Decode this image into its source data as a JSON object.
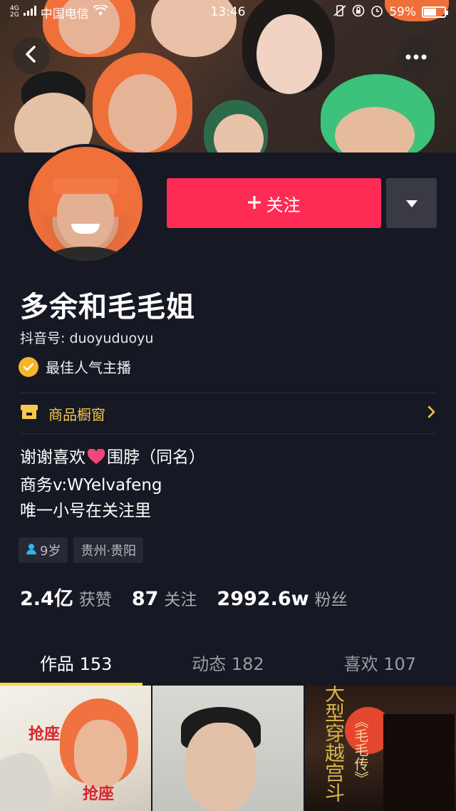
{
  "status_bar": {
    "network_top": "4G",
    "network_bottom": "2G",
    "carrier": "中国电信",
    "time": "13:46",
    "battery": "59%",
    "battery_level": 0.59
  },
  "profile": {
    "name": "多余和毛毛姐",
    "douyin_id": "抖音号: duoyuduoyu",
    "verification": "最佳人气主播",
    "follow_label": "关注",
    "shop_label": "商品橱窗",
    "bio_lines": [
      "谢谢喜欢",
      "围脖（同名）",
      "商务v:WYelvafeng",
      "唯一小号在关注里"
    ],
    "tags": {
      "age": "9岁",
      "location": "贵州·贵阳"
    }
  },
  "stats": {
    "likes_num": "2.4亿",
    "likes_label": "获赞",
    "following_num": "87",
    "following_label": "关注",
    "followers_num": "2992.6w",
    "followers_label": "粉丝"
  },
  "tabs": [
    {
      "label": "作品 153",
      "active": true
    },
    {
      "label": "动态 182",
      "active": false
    },
    {
      "label": "喜欢 107",
      "active": false
    }
  ],
  "thumbnails": {
    "thumb1_text_a": "抢座",
    "thumb1_text_b": "抢座",
    "thumb3_text_a": "大型穿越宫斗",
    "thumb3_text_b": "《毛毛传》"
  },
  "colors": {
    "background": "#161823",
    "follow_button": "#fe2c55",
    "accent_yellow": "#f8d73c",
    "shop_text": "#f6c94a"
  },
  "icons": {
    "back": "chevron-left-icon",
    "more": "more-dots-icon",
    "dropdown": "triangle-down-icon",
    "verify": "check-badge-icon",
    "shop": "storefront-icon",
    "heart": "heart-icon",
    "gender": "user-icon"
  }
}
